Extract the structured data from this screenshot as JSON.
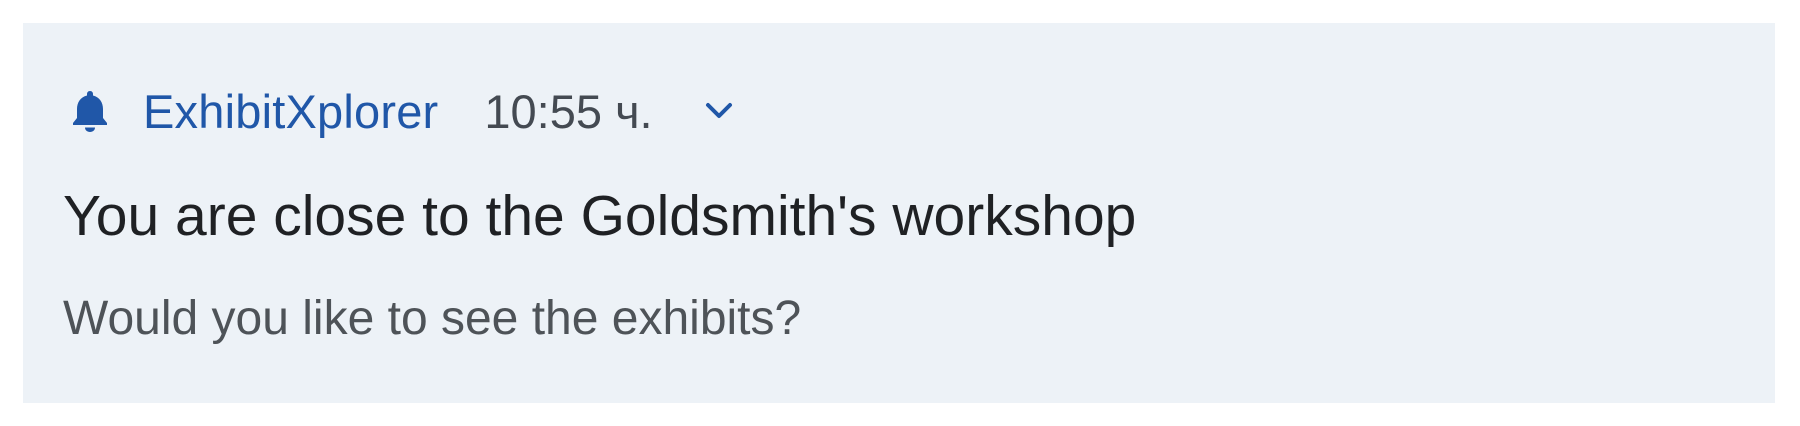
{
  "notification": {
    "app_icon": "bell-icon",
    "app_name": "ExhibitXplorer",
    "time": "10:55 ч.",
    "expand_icon": "chevron-down-icon",
    "title": "You are close to the Goldsmith's workshop",
    "body": "Would you like to see the exhibits?"
  },
  "colors": {
    "background": "#edf2f7",
    "accent": "#2057a8",
    "title_text": "#1f2124",
    "body_text": "#4e5358"
  }
}
